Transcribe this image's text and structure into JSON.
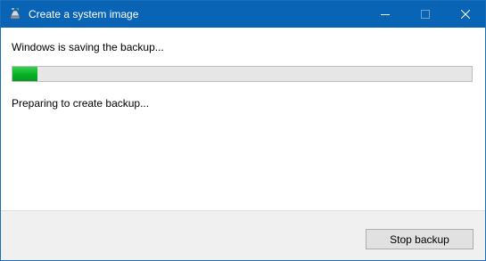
{
  "window": {
    "title": "Create a system image",
    "icon": "backup-drive-icon",
    "controls": {
      "minimize_icon": "minimize-icon",
      "maximize_icon": "maximize-icon",
      "close_icon": "close-icon"
    }
  },
  "content": {
    "heading": "Windows is saving the backup...",
    "progress": {
      "fraction": 0.055,
      "color": "#06b025"
    },
    "detail": "Preparing to create backup..."
  },
  "footer": {
    "stop_label": "Stop backup"
  },
  "colors": {
    "titlebar": "#0a64b6",
    "footer": "#f0f0f0"
  }
}
